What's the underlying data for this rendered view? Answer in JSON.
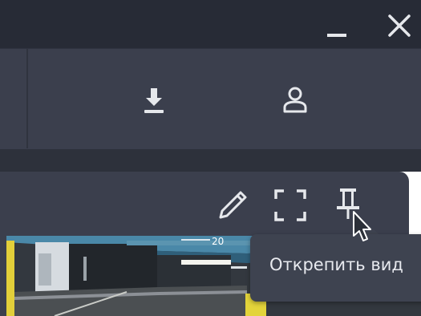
{
  "window": {
    "minimize_icon": "minimize-icon",
    "close_icon": "close-icon"
  },
  "toolbar": {
    "download_icon": "download-icon",
    "user_icon": "user-icon"
  },
  "panel": {
    "edit_icon": "pencil-icon",
    "fullscreen_icon": "fullscreen-icon",
    "pin_icon": "pin-icon"
  },
  "video": {
    "timestamp_fragment": "20"
  },
  "tooltip": {
    "text": "Открепить вид"
  },
  "colors": {
    "titlebar": "#272b36",
    "toolbar": "#3b3f4d",
    "icon": "#e6e8ec",
    "tooltip_bg": "#3e4350"
  }
}
